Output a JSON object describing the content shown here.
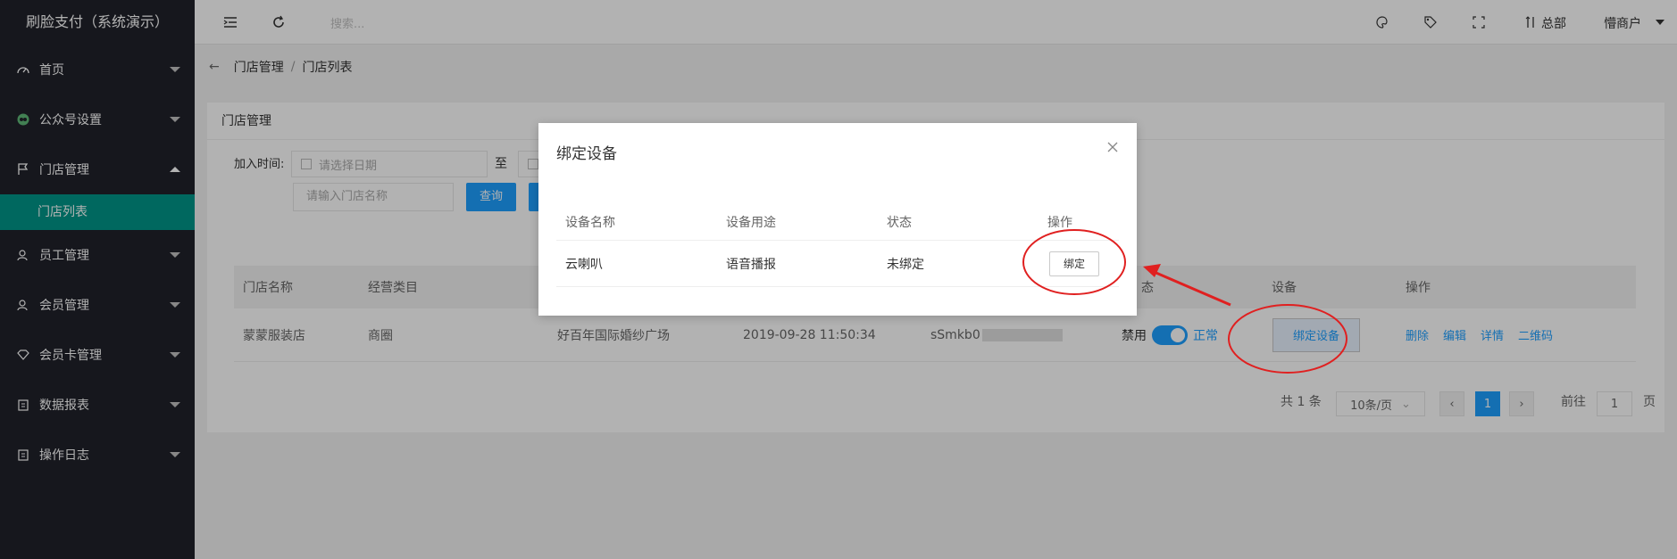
{
  "sidebar": {
    "logo": "刷脸支付（系统演示）",
    "items": [
      {
        "label": "首页"
      },
      {
        "label": "公众号设置"
      },
      {
        "label": "门店管理"
      },
      {
        "label": "员工管理"
      },
      {
        "label": "会员管理"
      },
      {
        "label": "会员卡管理"
      },
      {
        "label": "数据报表"
      },
      {
        "label": "操作日志"
      }
    ],
    "sub_item": "门店列表"
  },
  "header": {
    "search_placeholder": "搜索...",
    "branch": "总部",
    "user": "懵商户"
  },
  "breadcrumb": {
    "parent": "门店管理",
    "current": "门店列表"
  },
  "card": {
    "title": "门店管理",
    "date_label": "加入时间:",
    "date_placeholder": "请选择日期",
    "zhi": "至",
    "name_placeholder": "请输入门店名称",
    "query_label": "查询"
  },
  "table": {
    "headers": {
      "name": "门店名称",
      "category": "经营类目",
      "status_partial": "态",
      "device": "设备",
      "ops": "操作"
    },
    "row": {
      "name": "蒙蒙服装店",
      "category": "商圈",
      "address": "好百年国际婚纱广场",
      "time": "2019-09-28 11:50:34",
      "code": "sSmkb0",
      "disabled": "禁用",
      "normal": "正常",
      "bind_device": "绑定设备",
      "ops": [
        "删除",
        "编辑",
        "详情",
        "二维码"
      ]
    }
  },
  "pager": {
    "total": "共 1 条",
    "per_page": "10条/页",
    "current": "1",
    "goto": "前往",
    "goto_value": "1",
    "page": "页"
  },
  "modal": {
    "title": "绑定设备",
    "headers": [
      "设备名称",
      "设备用途",
      "状态",
      "操作"
    ],
    "row": {
      "name": "云喇叭",
      "usage": "语音播报",
      "status": "未绑定",
      "action": "绑定"
    }
  },
  "colors": {
    "sidebar": "#20222a",
    "accent": "#009688",
    "primary": "#1e9fff",
    "annotation": "#e02020"
  }
}
